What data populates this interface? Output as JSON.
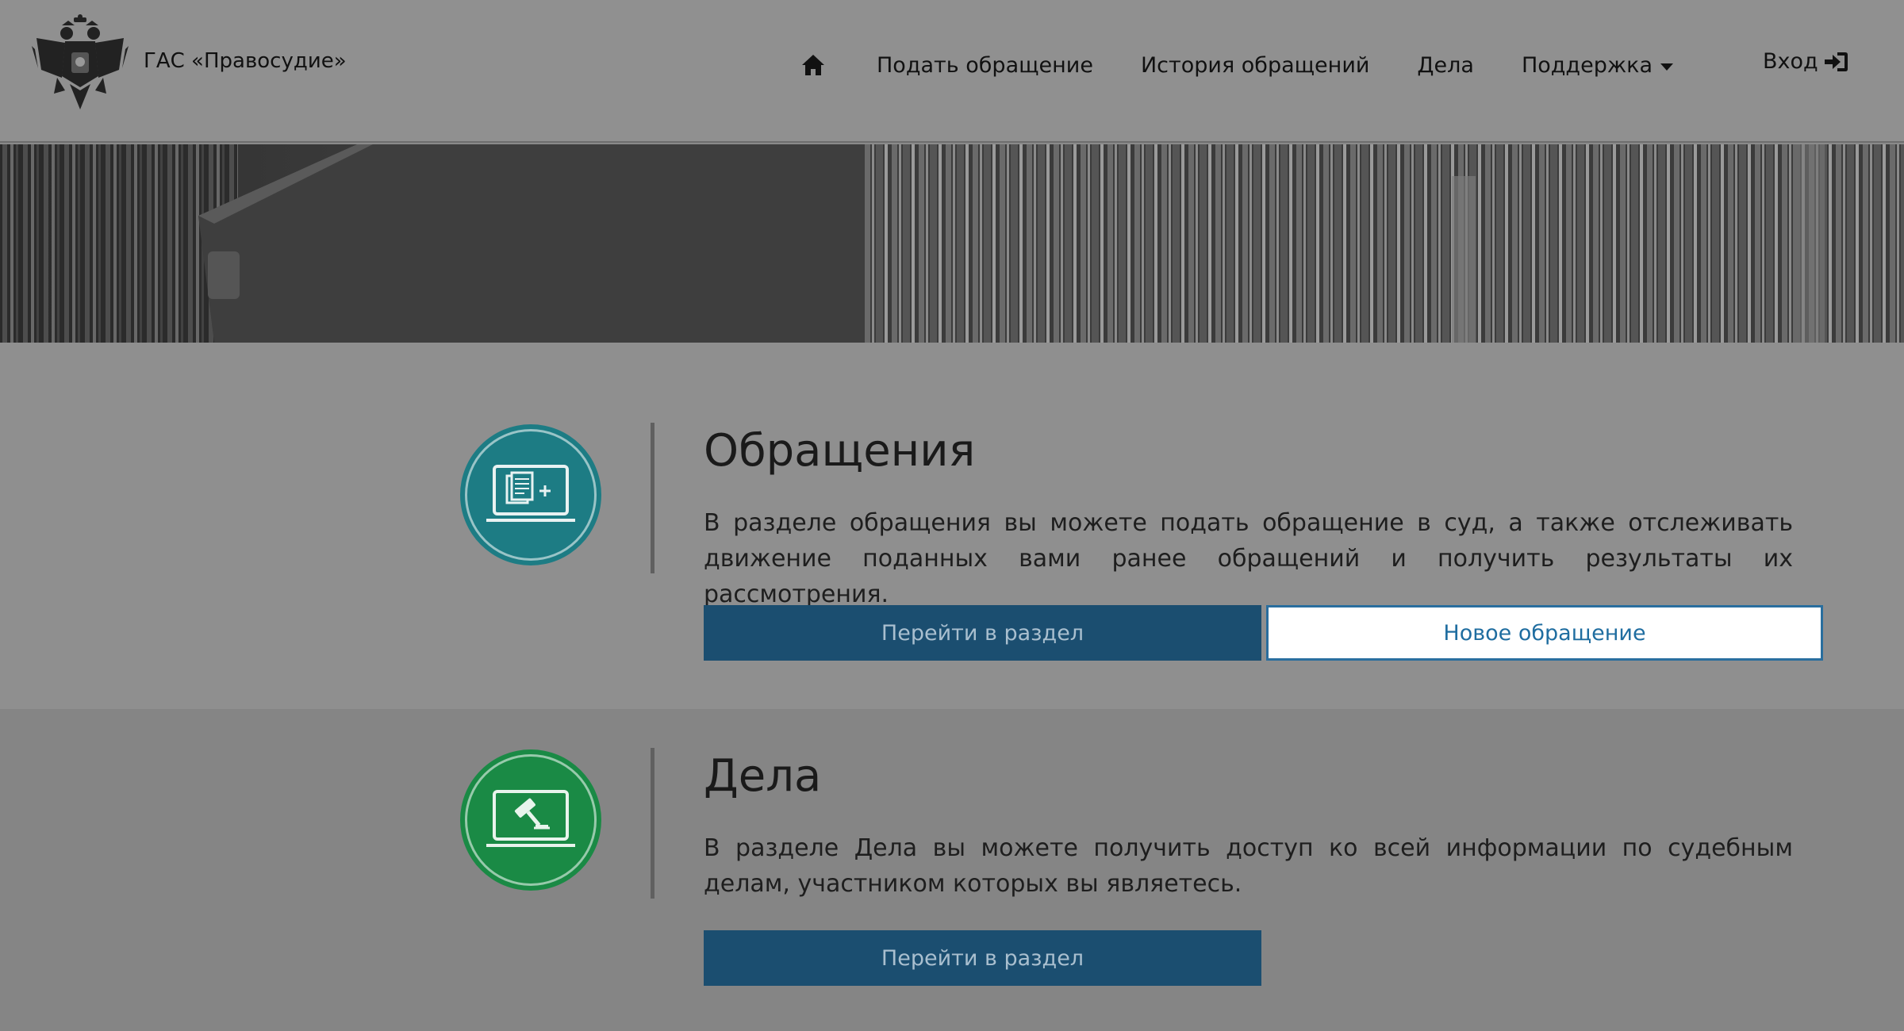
{
  "header": {
    "site_title": "ГАС «Правосудие»",
    "nav": [
      {
        "label": "Подать обращение"
      },
      {
        "label": "История обращений"
      },
      {
        "label": "Дела"
      },
      {
        "label": "Поддержка"
      }
    ],
    "login_label": "Вход"
  },
  "sections": [
    {
      "title": "Обращения",
      "text": "В разделе обращения вы можете подать обращение в суд, а также отслеживать движение поданных вами ранее обращений и получить результаты их рассмотрения.",
      "primary_button": "Перейти в раздел",
      "secondary_button": "Новое обращение",
      "icon": "new-document-laptop-icon",
      "color": "#1d7c84"
    },
    {
      "title": "Дела",
      "text": "В разделе Дела вы можете получить доступ ко всей информации по судебным делам, участником которых вы являетесь.",
      "primary_button": "Перейти в раздел",
      "icon": "gavel-laptop-icon",
      "color": "#1a8a45"
    }
  ]
}
